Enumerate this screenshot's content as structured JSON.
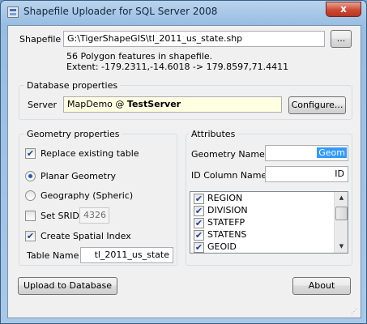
{
  "window": {
    "title": "Shapefile Uploader for SQL Server 2008",
    "close_glyph": "x",
    "app_icon": "app-icon"
  },
  "shapefile": {
    "label": "Shapefile",
    "path": "G:\\TigerShapeGIS\\tl_2011_us_state.shp",
    "browse_label": "...",
    "info_line1": "56 Polygon features in shapefile.",
    "info_line2": "Extent: -179.2311,-14.6018 -> 179.8597,71.4411"
  },
  "database": {
    "group_title": "Database properties",
    "server_label": "Server",
    "server_name": "MapDemo @",
    "server_host": "TestServer",
    "configure_label": "Configure..."
  },
  "geometry": {
    "group_title": "Geometry properties",
    "replace_label": "Replace existing table",
    "replace_checked": true,
    "planar_label": "Planar Geometry",
    "planar_selected": true,
    "geography_label": "Geography (Spheric)",
    "geography_selected": false,
    "srid_label": "Set SRID",
    "srid_checked": false,
    "srid_value": "4326",
    "spatial_index_label": "Create Spatial Index",
    "spatial_index_checked": true,
    "table_name_label": "Table Name",
    "table_name_value": "tl_2011_us_state"
  },
  "attributes": {
    "group_title": "Attributes",
    "geometry_name_label": "Geometry Name",
    "geometry_name_value": "Geom",
    "id_column_label": "ID Column Name",
    "id_column_value": "ID",
    "fields": [
      {
        "label": "REGION",
        "checked": true
      },
      {
        "label": "DIVISION",
        "checked": true
      },
      {
        "label": "STATEFP",
        "checked": true
      },
      {
        "label": "STATENS",
        "checked": true
      },
      {
        "label": "GEOID",
        "checked": true
      }
    ]
  },
  "footer": {
    "upload_label": "Upload to Database",
    "about_label": "About"
  },
  "colors": {
    "server_field_bg": "#ffffe1",
    "selection_bg": "#3399ff",
    "close_button": "#cc4a33"
  }
}
